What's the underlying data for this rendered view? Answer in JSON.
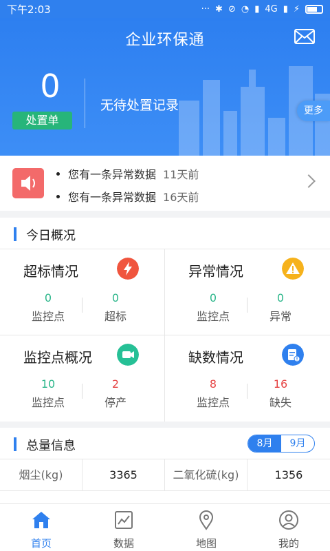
{
  "status_bar": {
    "time": "下午2:03",
    "network": "4G",
    "icons": [
      "more-dots-icon",
      "bluetooth-icon",
      "mute-icon",
      "alarm-icon",
      "signal-icon",
      "wifi-icon",
      "charging-icon",
      "battery-icon"
    ]
  },
  "header": {
    "title": "企业环保通",
    "count": "0",
    "dispose_label": "处置单",
    "no_record_text": "无待处置记录",
    "more_label": "更多"
  },
  "notices": [
    {
      "text": "您有一条异常数据",
      "time": "11天前"
    },
    {
      "text": "您有一条异常数据",
      "time": "16天前"
    }
  ],
  "today": {
    "title": "今日概况",
    "cards": [
      {
        "title": "超标情况",
        "icon": "lightning-icon",
        "icon_color": "#f0553e",
        "stats": [
          {
            "value": "0",
            "label": "监控点",
            "color": "green"
          },
          {
            "value": "0",
            "label": "超标",
            "color": "green"
          }
        ]
      },
      {
        "title": "异常情况",
        "icon": "warning-icon",
        "icon_color": "#f6b21c",
        "stats": [
          {
            "value": "0",
            "label": "监控点",
            "color": "green"
          },
          {
            "value": "0",
            "label": "异常",
            "color": "green"
          }
        ]
      },
      {
        "title": "监控点概况",
        "icon": "video-camera-icon",
        "icon_color": "#26c096",
        "stats": [
          {
            "value": "10",
            "label": "监控点",
            "color": "green"
          },
          {
            "value": "2",
            "label": "停产",
            "color": "red"
          }
        ]
      },
      {
        "title": "缺数情况",
        "icon": "document-alert-icon",
        "icon_color": "#2f80ee",
        "stats": [
          {
            "value": "8",
            "label": "监控点",
            "color": "red"
          },
          {
            "value": "16",
            "label": "缺失",
            "color": "red"
          }
        ]
      }
    ]
  },
  "total": {
    "title": "总量信息",
    "months": [
      "8月",
      "9月"
    ],
    "active_month": "8月",
    "rows": [
      [
        {
          "key": "烟尘(kg)",
          "value": "3365"
        },
        {
          "key": "二氧化硫(kg)",
          "value": "1356"
        }
      ]
    ]
  },
  "tabs": [
    {
      "label": "首页",
      "icon": "home-icon",
      "active": true
    },
    {
      "label": "数据",
      "icon": "chart-icon",
      "active": false
    },
    {
      "label": "地图",
      "icon": "map-pin-icon",
      "active": false
    },
    {
      "label": "我的",
      "icon": "user-icon",
      "active": false
    }
  ],
  "colors": {
    "primary": "#2f80ee",
    "green": "#2bb68a",
    "red": "#e64545",
    "dispose_green": "#27b57a"
  }
}
